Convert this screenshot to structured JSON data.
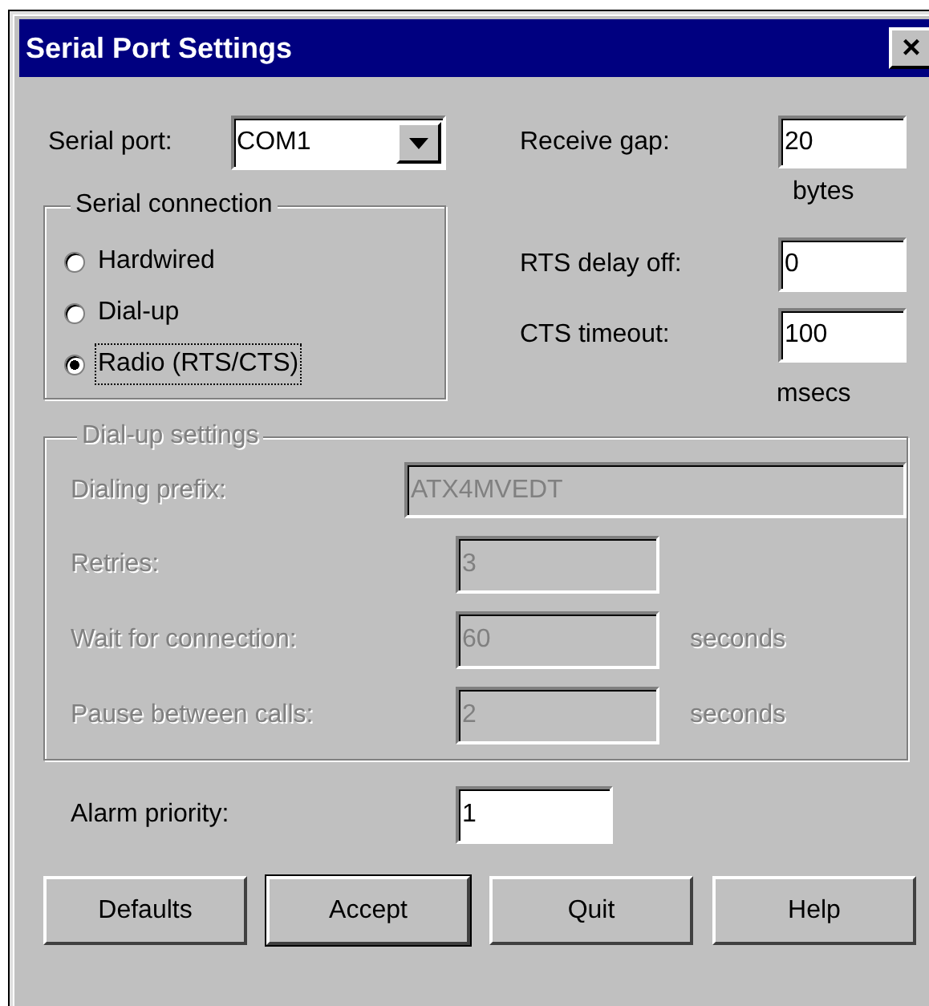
{
  "window": {
    "title": "Serial Port Settings",
    "close": "×"
  },
  "serial_port": {
    "label": "Serial port:",
    "value": "COM1"
  },
  "serial_connection": {
    "title": "Serial connection",
    "options": [
      {
        "label": "Hardwired",
        "selected": false,
        "focused": false
      },
      {
        "label": "Dial-up",
        "selected": false,
        "focused": false
      },
      {
        "label": "Radio (RTS/CTS)",
        "selected": true,
        "focused": true
      }
    ]
  },
  "receive_gap": {
    "label": "Receive gap:",
    "value": "20",
    "unit": "bytes"
  },
  "rts_delay_off": {
    "label": "RTS delay off:",
    "value": "0"
  },
  "cts_timeout": {
    "label": "CTS timeout:",
    "value": "100",
    "unit": "msecs"
  },
  "dialup_settings": {
    "title": "Dial-up settings",
    "disabled": true,
    "dialing_prefix": {
      "label": "Dialing prefix:",
      "value": "ATX4MVEDT"
    },
    "rows": [
      {
        "label": "Retries:",
        "value": "3"
      },
      {
        "label": "Wait for connection:",
        "value": "60",
        "unit": "seconds"
      },
      {
        "label": "Pause between calls:",
        "value": "2",
        "unit": "seconds"
      }
    ]
  },
  "alarm_priority": {
    "label": "Alarm priority:",
    "value": "1"
  },
  "buttons": [
    {
      "label": "Defaults",
      "default": false
    },
    {
      "label": "Accept",
      "default": true
    },
    {
      "label": "Quit",
      "default": false
    },
    {
      "label": "Help",
      "default": false
    }
  ]
}
